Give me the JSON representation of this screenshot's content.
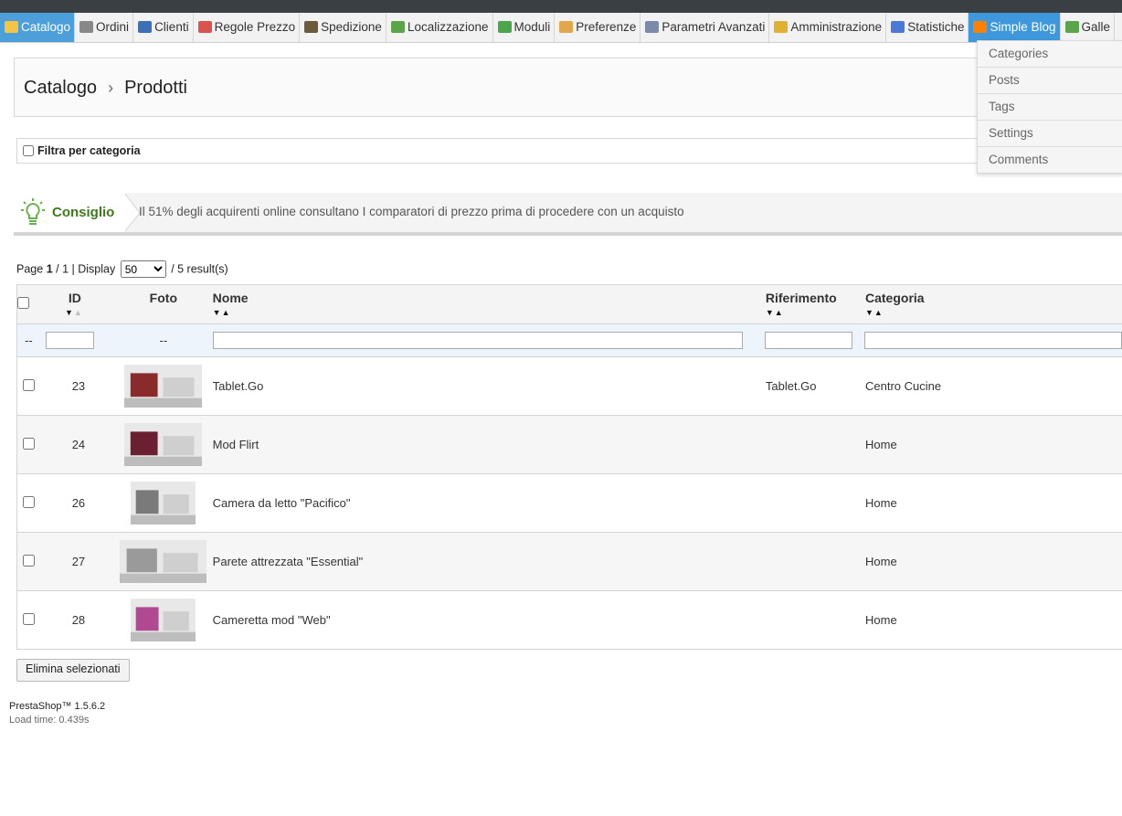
{
  "menu": [
    {
      "label": "Catalogo",
      "icon": "folder-icon",
      "color": "#f4c542",
      "active": true
    },
    {
      "label": "Ordini",
      "icon": "cart-icon",
      "color": "#888888"
    },
    {
      "label": "Clienti",
      "icon": "user-icon",
      "color": "#3b6fb6"
    },
    {
      "label": "Regole Prezzo",
      "icon": "price-tag-icon",
      "color": "#d9534f"
    },
    {
      "label": "Spedizione",
      "icon": "truck-icon",
      "color": "#6b5a3c"
    },
    {
      "label": "Localizzazione",
      "icon": "globe-icon",
      "color": "#5aa54a"
    },
    {
      "label": "Moduli",
      "icon": "puzzle-icon",
      "color": "#4aa64a"
    },
    {
      "label": "Preferenze",
      "icon": "pencil-icon",
      "color": "#e0a84a"
    },
    {
      "label": "Parametri Avanzati",
      "icon": "wrench-icon",
      "color": "#7a8aa8"
    },
    {
      "label": "Amministrazione",
      "icon": "key-icon",
      "color": "#e0b030"
    },
    {
      "label": "Statistiche",
      "icon": "chart-icon",
      "color": "#4a7ad6"
    },
    {
      "label": "Simple Blog",
      "icon": "blog-icon",
      "color": "#ff7f00",
      "hover": true
    },
    {
      "label": "Galle",
      "icon": "gallery-icon",
      "color": "#5aa54a"
    }
  ],
  "dropdown": [
    "Categories",
    "Posts",
    "Tags",
    "Settings",
    "Comments"
  ],
  "breadcrumb": {
    "parent": "Catalogo",
    "separator": "›",
    "current": "Prodotti"
  },
  "filter_label": "Filtra per categoria",
  "tip": {
    "label": "Consiglio",
    "message": "Il 51% degli acquirenti online consultano I comparatori di prezzo prima di procedere con un acquisto"
  },
  "pager": {
    "page_word": "Page",
    "page": "1",
    "total": "1",
    "display_word": "| Display",
    "per_page": "50",
    "results": "/ 5 result(s)"
  },
  "columns": {
    "id": "ID",
    "foto": "Foto",
    "nome": "Nome",
    "riferimento": "Riferimento",
    "categoria": "Categoria"
  },
  "filter_placeholder": "--",
  "rows": [
    {
      "id": "23",
      "nome": "Tablet.Go",
      "riferimento": "Tablet.Go",
      "categoria": "Centro Cucine",
      "thumb": "#8a2a2a"
    },
    {
      "id": "24",
      "nome": "Mod Flirt",
      "riferimento": "",
      "categoria": "Home",
      "thumb": "#6a2030"
    },
    {
      "id": "26",
      "nome": "Camera da letto \"Pacifico\"",
      "riferimento": "",
      "categoria": "Home",
      "thumb": "#7a7a7a"
    },
    {
      "id": "27",
      "nome": "Parete attrezzata \"Essential\"",
      "riferimento": "",
      "categoria": "Home",
      "thumb": "#9a9a9a"
    },
    {
      "id": "28",
      "nome": "Cameretta mod \"Web\"",
      "riferimento": "",
      "categoria": "Home",
      "thumb": "#b04a90"
    }
  ],
  "delete_button": "Elimina selezionati",
  "footer": {
    "version": "PrestaShop™ 1.5.6.2",
    "load_time": "Load time: 0.439s"
  }
}
